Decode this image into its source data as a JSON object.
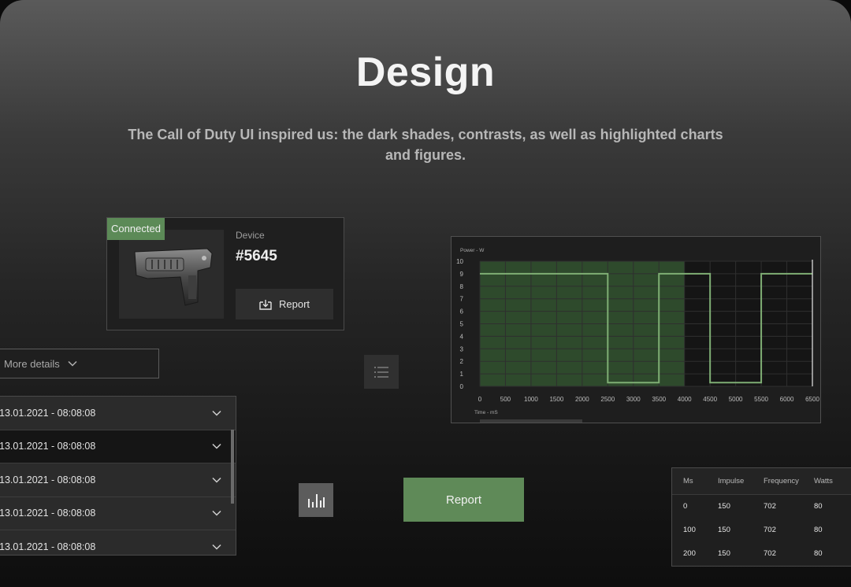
{
  "header": {
    "title": "Design",
    "subtitle": "The Call of Duty UI inspired us: the dark shades, contrasts, as well as highlighted charts and figures."
  },
  "device_card": {
    "status": "Connected",
    "label": "Device",
    "id": "#5645",
    "report_label": "Report"
  },
  "more_details": {
    "label": "More details"
  },
  "date_list": {
    "items": [
      "13.01.2021 - 08:08:08",
      "13.01.2021 - 08:08:08",
      "13.01.2021 - 08:08:08",
      "13.01.2021 - 08:08:08",
      "13.01.2021 - 08:08:08"
    ],
    "selected_index": 1
  },
  "report_button": {
    "label": "Report"
  },
  "icons": {
    "list": "list-icon",
    "bars": "bar-chart-icon",
    "chevron": "chevron-down-icon",
    "download": "download-icon"
  },
  "colors": {
    "accent_green": "#5f8a58",
    "chart_line": "#7fae74",
    "chart_fill": "#2e4a2c"
  },
  "chart_data": {
    "type": "line",
    "ylabel": "Power - W",
    "xlabel": "Time - mS",
    "ylim": [
      0,
      10
    ],
    "xlim": [
      0,
      6500
    ],
    "x_ticks": [
      0,
      500,
      1000,
      1500,
      2000,
      2500,
      3000,
      3500,
      4000,
      4500,
      5000,
      5500,
      6000,
      6500
    ],
    "y_ticks": [
      0,
      1,
      2,
      3,
      4,
      5,
      6,
      7,
      8,
      9,
      10
    ],
    "highlight_range": [
      0,
      4000
    ],
    "series": [
      {
        "x": [
          0,
          2500,
          2500,
          3500,
          3500,
          4500,
          4500,
          5500,
          5500,
          6500
        ],
        "y": [
          9,
          9,
          0.3,
          0.3,
          9,
          9,
          0.3,
          0.3,
          9,
          9
        ]
      }
    ]
  },
  "table": {
    "headers": [
      "Ms",
      "Impulse",
      "Frequency",
      "Watts"
    ],
    "rows": [
      [
        "0",
        "150",
        "702",
        "80"
      ],
      [
        "100",
        "150",
        "702",
        "80"
      ],
      [
        "200",
        "150",
        "702",
        "80"
      ]
    ]
  }
}
